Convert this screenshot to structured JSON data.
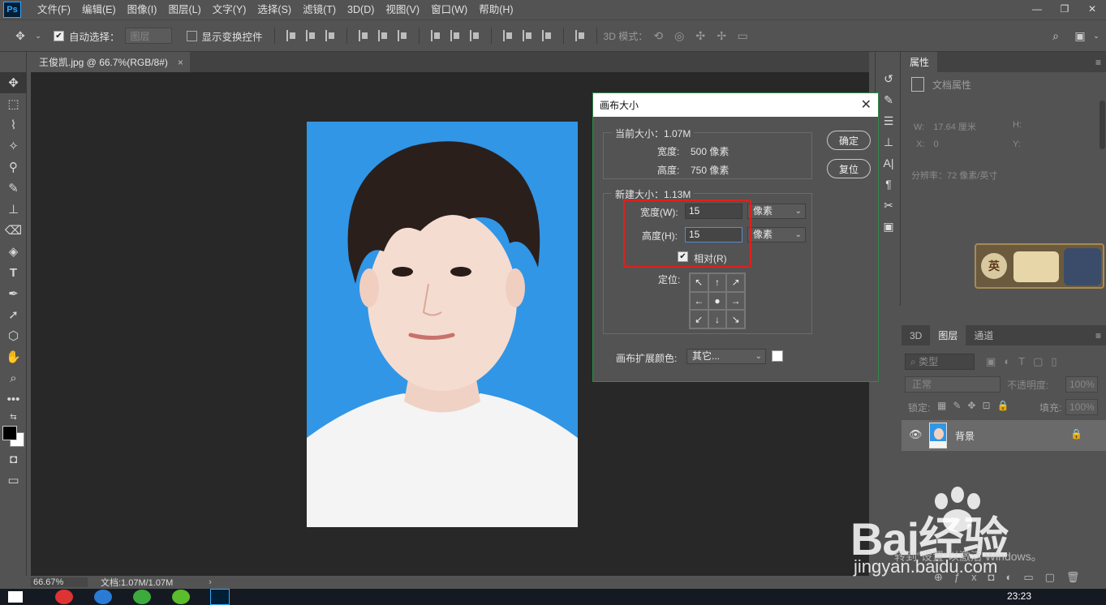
{
  "app": {
    "logo": "Ps"
  },
  "menu": [
    "文件(F)",
    "编辑(E)",
    "图像(I)",
    "图层(L)",
    "文字(Y)",
    "选择(S)",
    "滤镜(T)",
    "3D(D)",
    "视图(V)",
    "窗口(W)",
    "帮助(H)"
  ],
  "options": {
    "auto_select_label": "自动选择：",
    "auto_select_target": "图层",
    "show_transform_label": "显示变换控件",
    "mode3d_label": "3D 模式："
  },
  "document": {
    "tab_title": "王俊凯.jpg @ 66.7%(RGB/8#)",
    "tab_close": "×"
  },
  "status": {
    "zoom": "66.67%",
    "doc_size": "文档:1.07M/1.07M"
  },
  "dialog": {
    "title": "画布大小",
    "close": "✕",
    "current": {
      "group_title": "当前大小：1.07M",
      "width_label": "宽度:",
      "width_value": "500 像素",
      "height_label": "高度:",
      "height_value": "750 像素"
    },
    "new": {
      "group_title": "新建大小：1.13M",
      "width_label": "宽度(W):",
      "width_value": "15",
      "width_unit": "像素",
      "height_label": "高度(H):",
      "height_value": "15",
      "height_unit": "像素",
      "relative_label": "相对(R)",
      "relative_checked": true,
      "anchor_label": "定位:"
    },
    "extension_color_label": "画布扩展颜色:",
    "extension_color_value": "其它...",
    "ok_label": "确定",
    "reset_label": "复位"
  },
  "properties": {
    "tab_label": "属性",
    "doc_props": "文档属性",
    "w_label": "W:",
    "w_value": "17.64 厘米",
    "h_label": "H:",
    "x_label": "X:",
    "x_value": "0",
    "y_label": "Y:",
    "resolution": "分辨率：72 像素/英寸"
  },
  "layers": {
    "tabs": [
      "3D",
      "图层",
      "通道"
    ],
    "kind_label": "类型",
    "blend_mode": "正常",
    "opacity_label": "不透明度:",
    "opacity_value": "100%",
    "lock_label": "锁定:",
    "fill_label": "填充:",
    "fill_value": "100%",
    "layer_name": "背景"
  },
  "taskbar": {
    "time": "23:23"
  },
  "watermark": {
    "brand": "Bai经验",
    "url": "jingyan.baidu.com",
    "activation": "转到\"设置\"以激活 Windows。"
  },
  "colors": {
    "highlight": "#e0201c",
    "photo_bg": "#3196e6",
    "ps_blue": "#31a8ff"
  }
}
